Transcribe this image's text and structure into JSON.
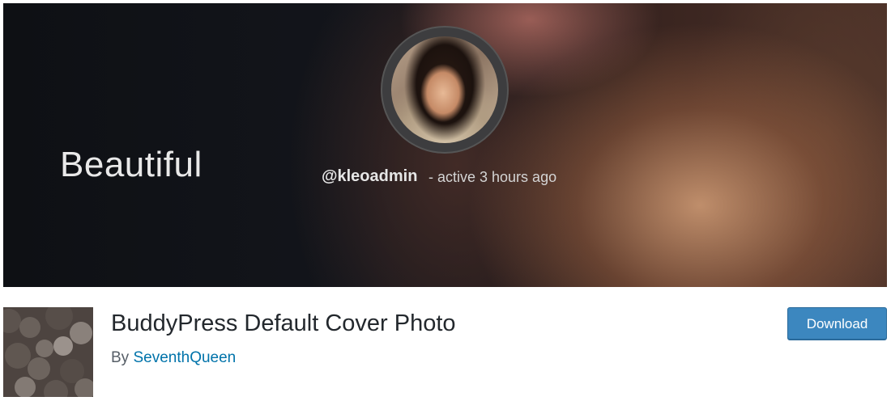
{
  "banner": {
    "title": "Beautiful",
    "username": "@kleoadmin",
    "activity": "- active 3 hours ago"
  },
  "plugin": {
    "name": "BuddyPress Default Cover Photo",
    "author_prefix": "By",
    "author_name": "SeventhQueen",
    "download_label": "Download"
  },
  "colors": {
    "accent_button": "#3c87bf",
    "author_link": "#0073aa",
    "plugin_title": "#23282d"
  }
}
